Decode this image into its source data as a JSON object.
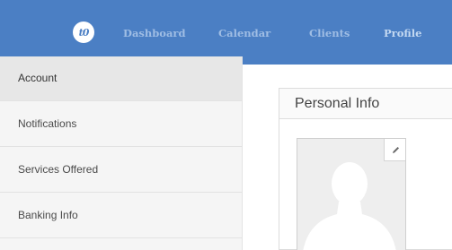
{
  "colors": {
    "topbar": "#4b7fc4",
    "nav_text": "#9fbde4",
    "sidebar_bg": "#f5f5f5",
    "sidebar_active": "#e7e7e7"
  },
  "topbar": {
    "logo_text": "t0",
    "nav": [
      {
        "label": "Dashboard"
      },
      {
        "label": "Calendar"
      },
      {
        "label": "Clients"
      },
      {
        "label": "Profile"
      }
    ]
  },
  "sidebar": {
    "items": [
      {
        "label": "Account"
      },
      {
        "label": "Notifications"
      },
      {
        "label": "Services Offered"
      },
      {
        "label": "Banking Info"
      }
    ]
  },
  "main": {
    "panel_title": "Personal Info",
    "avatar": {
      "icon": "default-avatar-silhouette",
      "edit_icon": "pencil-icon"
    }
  }
}
